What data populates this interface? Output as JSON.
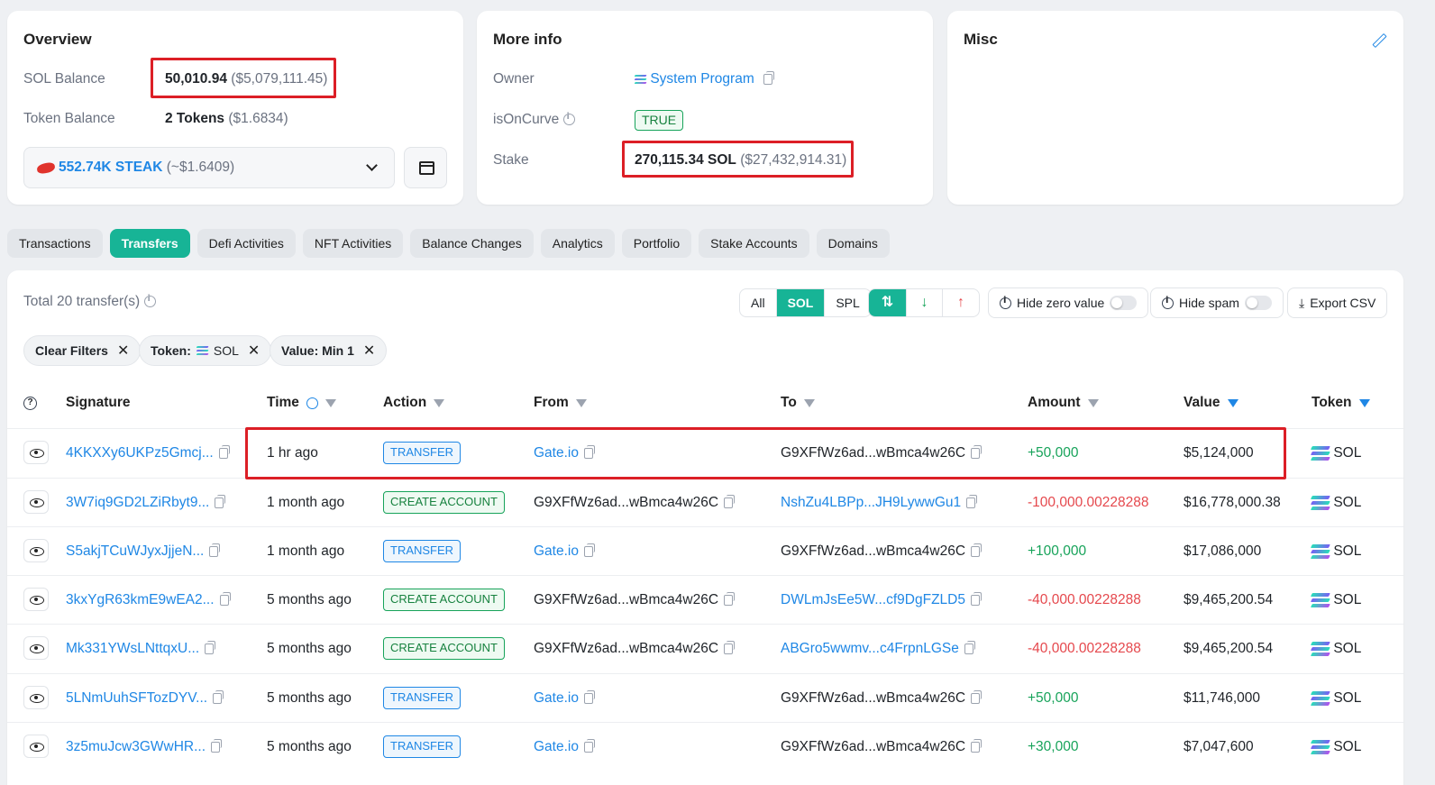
{
  "overview": {
    "title": "Overview",
    "sol_balance_label": "SOL Balance",
    "sol_balance_value": "50,010.94",
    "sol_balance_usd": "($5,079,111.45)",
    "token_balance_label": "Token Balance",
    "token_balance_value": "2 Tokens",
    "token_balance_usd": "($1.6834)",
    "token_select_value": "552.74K STEAK",
    "token_select_usd": "(~$1.6409)"
  },
  "more_info": {
    "title": "More info",
    "owner_label": "Owner",
    "owner_value": "System Program",
    "oncurve_label": "isOnCurve",
    "oncurve_value": "TRUE",
    "stake_label": "Stake",
    "stake_value": "270,115.34 SOL",
    "stake_usd": "($27,432,914.31)"
  },
  "misc": {
    "title": "Misc"
  },
  "tabs": [
    "Transactions",
    "Transfers",
    "Defi Activities",
    "NFT Activities",
    "Balance Changes",
    "Analytics",
    "Portfolio",
    "Stake Accounts",
    "Domains"
  ],
  "active_tab": "Transfers",
  "transfers": {
    "total_label": "Total 20 transfer(s)",
    "token_filter": [
      "All",
      "SOL",
      "SPL"
    ],
    "hide_zero_label": "Hide zero value",
    "hide_spam_label": "Hide spam",
    "export_label": "Export CSV",
    "chips": {
      "clear": "Clear Filters",
      "token_label": "Token:",
      "token_value": "SOL",
      "value": "Value: Min 1"
    }
  },
  "columns": {
    "signature": "Signature",
    "time": "Time",
    "action": "Action",
    "from": "From",
    "to": "To",
    "amount": "Amount",
    "value": "Value",
    "token": "Token"
  },
  "rows": [
    {
      "signature": "4KKXXy6UKPz5Gmcj...",
      "time": "1 hr ago",
      "action": "TRANSFER",
      "from": "Gate.io",
      "to": "G9XFfWz6ad...wBmca4w26C",
      "amount": "+50,000",
      "value": "$5,124,000",
      "token": "SOL"
    },
    {
      "signature": "3W7iq9GD2LZiRbyt9...",
      "time": "1 month ago",
      "action": "CREATE ACCOUNT",
      "from": "G9XFfWz6ad...wBmca4w26C",
      "to": "NshZu4LBPp...JH9LywwGu1",
      "amount": "-100,000.00228288",
      "value": "$16,778,000.38",
      "token": "SOL"
    },
    {
      "signature": "S5akjTCuWJyxJjjeN...",
      "time": "1 month ago",
      "action": "TRANSFER",
      "from": "Gate.io",
      "to": "G9XFfWz6ad...wBmca4w26C",
      "amount": "+100,000",
      "value": "$17,086,000",
      "token": "SOL"
    },
    {
      "signature": "3kxYgR63kmE9wEA2...",
      "time": "5 months ago",
      "action": "CREATE ACCOUNT",
      "from": "G9XFfWz6ad...wBmca4w26C",
      "to": "DWLmJsEe5W...cf9DgFZLD5",
      "amount": "-40,000.00228288",
      "value": "$9,465,200.54",
      "token": "SOL"
    },
    {
      "signature": "Mk331YWsLNttqxU...",
      "time": "5 months ago",
      "action": "CREATE ACCOUNT",
      "from": "G9XFfWz6ad...wBmca4w26C",
      "to": "ABGro5wwmv...c4FrpnLGSe",
      "amount": "-40,000.00228288",
      "value": "$9,465,200.54",
      "token": "SOL"
    },
    {
      "signature": "5LNmUuhSFTozDYV...",
      "time": "5 months ago",
      "action": "TRANSFER",
      "from": "Gate.io",
      "to": "G9XFfWz6ad...wBmca4w26C",
      "amount": "+50,000",
      "value": "$11,746,000",
      "token": "SOL"
    },
    {
      "signature": "3z5muJcw3GWwHR...",
      "time": "5 months ago",
      "action": "TRANSFER",
      "from": "Gate.io",
      "to": "G9XFfWz6ad...wBmca4w26C",
      "amount": "+30,000",
      "value": "$7,047,600",
      "token": "SOL"
    }
  ],
  "colors": {
    "accent": "#17b496",
    "link": "#1f87e5",
    "positive": "#17a35a",
    "negative": "#e5484d",
    "highlight_box": "#dc1f26"
  }
}
